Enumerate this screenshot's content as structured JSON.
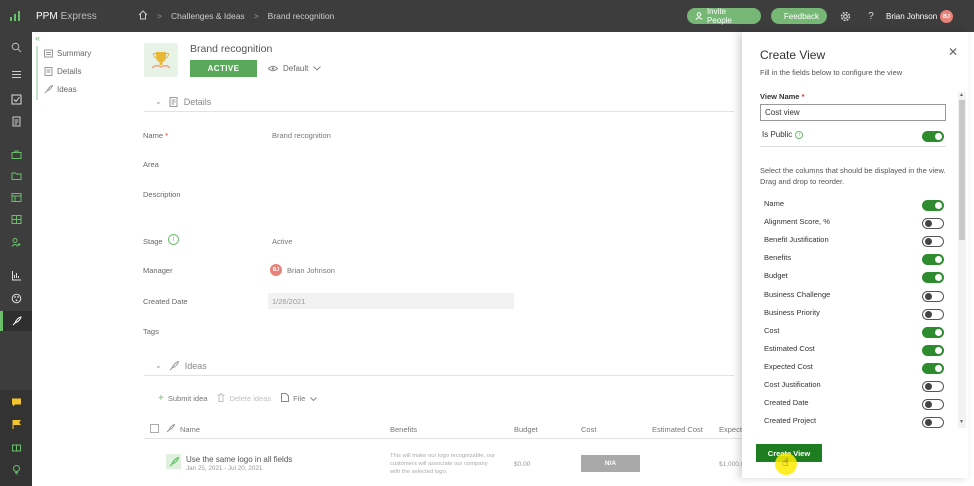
{
  "app": {
    "name": "PPM",
    "sub": "Express"
  },
  "breadcrumb": {
    "items": [
      "Challenges & Ideas",
      "Brand recognition"
    ]
  },
  "topbar": {
    "invite_label": "Invite People",
    "feedback_label": "Feedback",
    "help_label": "?",
    "user_name": "Brian Johnson",
    "user_initials": "BJ"
  },
  "subnav": {
    "items": [
      {
        "label": "Summary"
      },
      {
        "label": "Details"
      },
      {
        "label": "Ideas"
      }
    ]
  },
  "project": {
    "title": "Brand recognition",
    "status": "ACTIVE",
    "view": "Default"
  },
  "details": {
    "header": "Details",
    "fields": {
      "name_label": "Name",
      "name_req": "*",
      "name_value": "Brand recognition",
      "area_label": "Area",
      "description_label": "Description",
      "stage_label": "Stage",
      "stage_value": "Active",
      "manager_label": "Manager",
      "manager_value": "Brian Johnson",
      "manager_initials": "BJ",
      "created_label": "Created Date",
      "created_value": "1/26/2021",
      "tags_label": "Tags"
    }
  },
  "ideas": {
    "header": "Ideas",
    "toolbar": {
      "submit": "Submit idea",
      "delete": "Delete ideas",
      "file": "File"
    },
    "columns": [
      "Name",
      "Benefits",
      "Budget",
      "Cost",
      "Estimated Cost",
      "Expect"
    ],
    "rows": [
      {
        "name": "Use the same logo in all fields",
        "dates": "Jan 25, 2021 - Jul 20, 2021",
        "benefits": "This will make our logo recognizable, our customers will associate our company with the selected logo.",
        "budget": "$0.00",
        "cost": "N/A",
        "extra": "$1,000,0"
      }
    ]
  },
  "panel": {
    "title": "Create View",
    "subtitle": "Fill in the fields below to configure the view",
    "view_name_label": "View Name",
    "view_name_req": "*",
    "view_name_value": "Cost view",
    "is_public_label": "Is Public",
    "is_public": true,
    "columns_desc": "Select the columns that should be displayed in the view. Drag and drop to reorder.",
    "columns": [
      {
        "label": "Name",
        "on": true
      },
      {
        "label": "Alignment Score, %",
        "on": false
      },
      {
        "label": "Benefit Justification",
        "on": false
      },
      {
        "label": "Benefits",
        "on": true
      },
      {
        "label": "Budget",
        "on": true
      },
      {
        "label": "Business Challenge",
        "on": false
      },
      {
        "label": "Business Priority",
        "on": false
      },
      {
        "label": "Cost",
        "on": true
      },
      {
        "label": "Estimated Cost",
        "on": true
      },
      {
        "label": "Expected Cost",
        "on": true
      },
      {
        "label": "Cost Justification",
        "on": false
      },
      {
        "label": "Created Date",
        "on": false
      },
      {
        "label": "Created Project",
        "on": false
      }
    ],
    "create_label": "Create View"
  },
  "colors": {
    "accent": "#6bbf6b",
    "toggle_on": "#2e8b2e",
    "topbar": "#3d3d3d",
    "create": "#1e7d1e"
  }
}
